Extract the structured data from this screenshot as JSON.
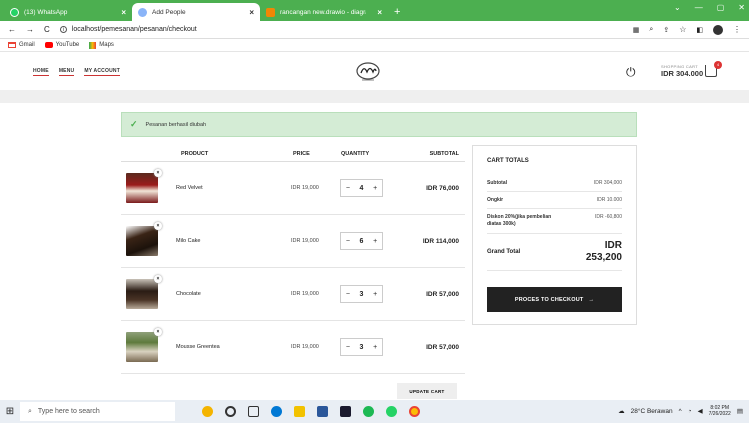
{
  "browser": {
    "tabs": [
      {
        "title": "(13) WhatsApp",
        "active": false
      },
      {
        "title": "Add People",
        "active": true
      },
      {
        "title": "rancangan new.drawio - diagram",
        "active": false
      }
    ],
    "url": "localhost/pemesanan/pesanan/checkout",
    "bookmarks": [
      "Gmail",
      "YouTube",
      "Maps"
    ]
  },
  "site": {
    "nav": [
      "HOME",
      "MENU",
      "MY ACCOUNT"
    ],
    "cart_label": "SHOPPING CART",
    "cart_amount": "IDR 304.000",
    "cart_count": "4"
  },
  "alert": {
    "message": "Pesanan berhasil diubah"
  },
  "table": {
    "headers": [
      "PRODUCT",
      "PRICE",
      "QUANTITY",
      "SUBTOTAL"
    ],
    "rows": [
      {
        "name": "Red Velvet",
        "price": "IDR 19,000",
        "qty": "4",
        "subtotal": "IDR 76,000"
      },
      {
        "name": "Milo Cake",
        "price": "IDR 19,000",
        "qty": "6",
        "subtotal": "IDR 114,000"
      },
      {
        "name": "Chocolate",
        "price": "IDR 19,000",
        "qty": "3",
        "subtotal": "IDR 57,000"
      },
      {
        "name": "Mousse Greentea",
        "price": "IDR 19,000",
        "qty": "3",
        "subtotal": "IDR 57,000"
      }
    ],
    "update_label": "UPDATE CART"
  },
  "totals": {
    "title": "CART TOTALS",
    "subtotal_label": "Subtotal",
    "subtotal": "IDR 304,000",
    "ongkir_label": "Ongkir",
    "ongkir": "IDR 10.000",
    "diskon_label": "Diskon 20%(jika pembelian diatas 300k)",
    "diskon": "IDR -60,800",
    "grand_label": "Grand Total",
    "grand_currency": "IDR",
    "grand_value": "253,200",
    "checkout_label": "PROCES TO CHECKOUT"
  },
  "taskbar": {
    "search_placeholder": "Type here to search",
    "weather": "28°C Berawan",
    "time": "8:02 PM",
    "date": "7/26/2022"
  },
  "colors": {
    "accent": "#4caf50",
    "dark_button": "#222222"
  }
}
